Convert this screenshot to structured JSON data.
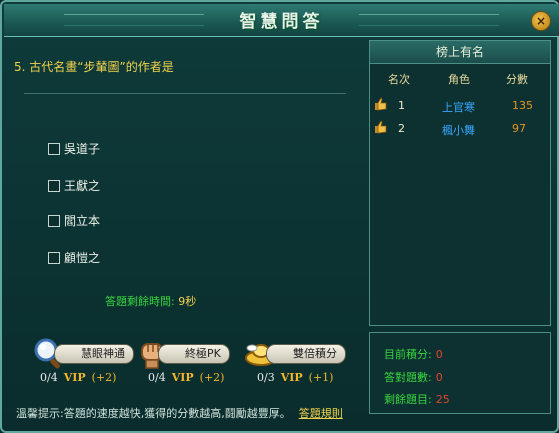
{
  "window": {
    "title": "智慧問答"
  },
  "question": {
    "text": "5. 古代名畫“步輦圖”的作者是"
  },
  "options": [
    "吳道子",
    "王獻之",
    "閻立本",
    "顧愷之"
  ],
  "timer": {
    "label": "答題剩餘時間:",
    "value": "9秒"
  },
  "tools": [
    {
      "label": "慧眼神通",
      "count": "0/4",
      "vip": "VIP",
      "bonus": "(+2)",
      "icon": "magnifier-icon"
    },
    {
      "label": "終極PK",
      "count": "0/4",
      "vip": "VIP",
      "bonus": "(+2)",
      "icon": "fist-icon"
    },
    {
      "label": "雙倍積分",
      "count": "0/3",
      "vip": "VIP",
      "bonus": "(+1)",
      "icon": "gold-ingot-icon"
    }
  ],
  "tip": {
    "text": "溫馨提示:答題的速度越快,獲得的分數越高,鬪勵越豐厚。",
    "link": "答題規則"
  },
  "leaderboard": {
    "title": "榜上有名",
    "columns": [
      "名次",
      "角色",
      "分數"
    ],
    "rows": [
      {
        "rank": "1",
        "name": "上官寒",
        "score": "135"
      },
      {
        "rank": "2",
        "name": "楓小舞",
        "score": "97"
      }
    ]
  },
  "stats": [
    {
      "label": "目前積分:",
      "value": "0"
    },
    {
      "label": "答對題數:",
      "value": "0"
    },
    {
      "label": "剩餘題目:",
      "value": "25"
    }
  ],
  "colors": {
    "accent_yellow": "#f0d24a",
    "green_text": "#38d53e",
    "blue_name": "#3aa6ff",
    "score_orange": "#e59421"
  }
}
